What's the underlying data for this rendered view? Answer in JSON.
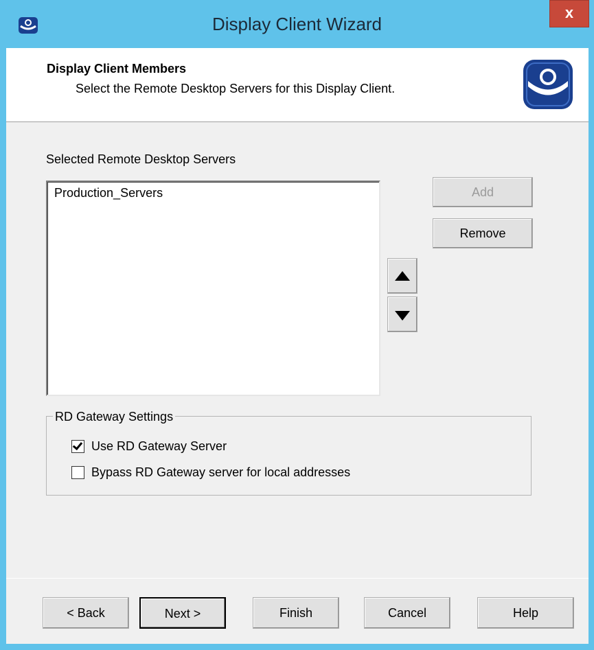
{
  "window": {
    "title": "Display Client Wizard",
    "close_label": "x"
  },
  "header": {
    "title": "Display Client Members",
    "subtitle": "Select the Remote Desktop Servers for this Display Client."
  },
  "selected_servers": {
    "label": "Selected Remote Desktop Servers",
    "items": [
      "Production_Servers"
    ]
  },
  "side_buttons": {
    "add_label": "Add",
    "add_enabled": false,
    "remove_label": "Remove"
  },
  "gateway": {
    "legend": "RD Gateway Settings",
    "use_gateway_label": "Use RD Gateway Server",
    "use_gateway_checked": true,
    "bypass_label": "Bypass RD Gateway server for local addresses",
    "bypass_checked": false
  },
  "footer": {
    "back_label": "< Back",
    "next_label": "Next >",
    "finish_label": "Finish",
    "cancel_label": "Cancel",
    "help_label": "Help"
  },
  "colors": {
    "titlebar": "#5fc2ea",
    "close_button": "#c7493a",
    "logo_blue": "#1a3f8f"
  }
}
